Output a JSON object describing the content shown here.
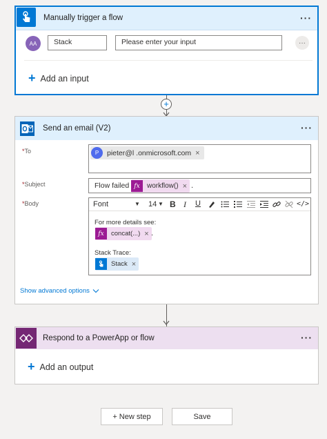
{
  "trigger": {
    "title": "Manually trigger a flow",
    "more": "···",
    "avatar_text": "AA",
    "input_name": "Stack",
    "input_placeholder": "Please enter your input",
    "row_more": "···",
    "add_input_label": "Add an input"
  },
  "connector_plus": "+",
  "email": {
    "title": "Send an email (V2)",
    "more": "···",
    "to": {
      "label": "To",
      "avatar": "P",
      "recipient": "pieter@l                            .onmicrosoft.com",
      "remove": "×"
    },
    "subject": {
      "label": "Subject",
      "prefix": "Flow failed",
      "token_label": "workflow()",
      "remove": "×",
      "suffix": "."
    },
    "body": {
      "label": "Body",
      "font": "Font",
      "size": "14",
      "line1": "For more details see:",
      "token1_label": "concat(...)",
      "token1_remove": "×",
      "token1_suffix": ".",
      "line2": "Stack Trace:",
      "token2_label": "Stack",
      "token2_remove": "×"
    },
    "advanced_link": "Show advanced options"
  },
  "respond": {
    "title": "Respond to a PowerApp or flow",
    "more": "···",
    "add_output_label": "Add an output"
  },
  "footer": {
    "new_step": "+ New step",
    "save": "Save"
  },
  "colors": {
    "accent": "#0078d4",
    "trigger_header": "#dff0fd",
    "respond_header": "#eddff0",
    "expression": "#9c1b94"
  }
}
